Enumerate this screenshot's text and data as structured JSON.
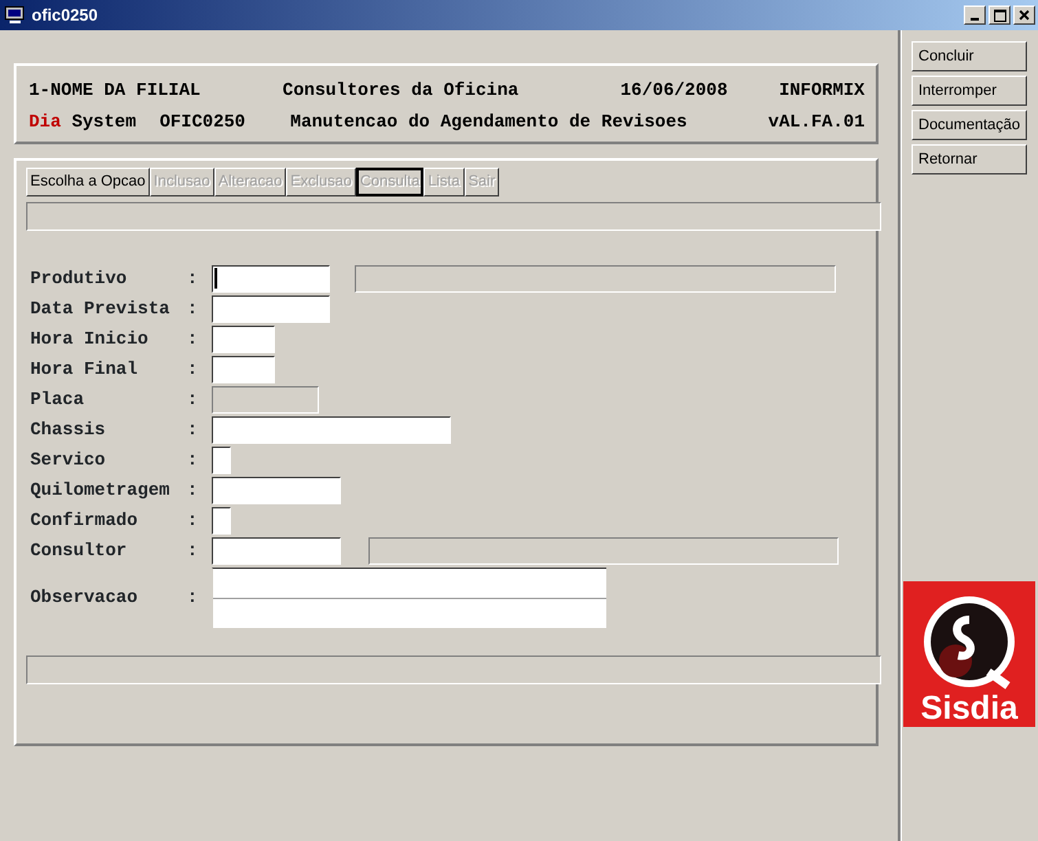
{
  "window": {
    "title": "ofic0250"
  },
  "header": {
    "branch": "1-NOME DA FILIAL",
    "module": "Consultores da Oficina",
    "date": "16/06/2008",
    "database": "INFORMIX",
    "brand_accent": "Dia",
    "brand_rest": "System",
    "program": "OFIC0250",
    "screen_title": "Manutencao do Agendamento de Revisoes",
    "version": "vAL.FA.01"
  },
  "menu": [
    {
      "label": "Escolha a Opcao",
      "disabled": false,
      "selected": false
    },
    {
      "label": "Inclusao",
      "disabled": true,
      "selected": false
    },
    {
      "label": "Alteracao",
      "disabled": true,
      "selected": false
    },
    {
      "label": "Exclusao",
      "disabled": true,
      "selected": false
    },
    {
      "label": "Consulta",
      "disabled": true,
      "selected": true
    },
    {
      "label": "Lista",
      "disabled": true,
      "selected": false
    },
    {
      "label": "Sair",
      "disabled": true,
      "selected": false
    }
  ],
  "fields": [
    {
      "label": "Produtivo",
      "kind": "code",
      "disabled": false,
      "focused": true,
      "description": true
    },
    {
      "label": "Data Prevista",
      "kind": "date",
      "disabled": false,
      "focused": false,
      "description": false
    },
    {
      "label": "Hora Inicio",
      "kind": "time",
      "disabled": false,
      "focused": false,
      "description": false
    },
    {
      "label": "Hora Final",
      "kind": "time",
      "disabled": false,
      "focused": false,
      "description": false
    },
    {
      "label": "Placa",
      "kind": "plate",
      "disabled": true,
      "focused": false,
      "description": false
    },
    {
      "label": "Chassis",
      "kind": "chassis",
      "disabled": false,
      "focused": false,
      "description": false
    },
    {
      "label": "Servico",
      "kind": "flag",
      "disabled": false,
      "focused": false,
      "description": false
    },
    {
      "label": "Quilometragem",
      "kind": "number",
      "disabled": false,
      "focused": false,
      "description": false
    },
    {
      "label": "Confirmado",
      "kind": "flag",
      "disabled": false,
      "focused": false,
      "description": false
    },
    {
      "label": "Consultor",
      "kind": "number",
      "disabled": false,
      "focused": false,
      "description": true
    },
    {
      "label": "Observacao",
      "kind": "memo",
      "disabled": false,
      "focused": false,
      "description": false
    }
  ],
  "separator": ":",
  "side_buttons": [
    "Concluir",
    "Interromper",
    "Documentação",
    "Retornar"
  ],
  "logo": {
    "text": "Sisdia"
  }
}
